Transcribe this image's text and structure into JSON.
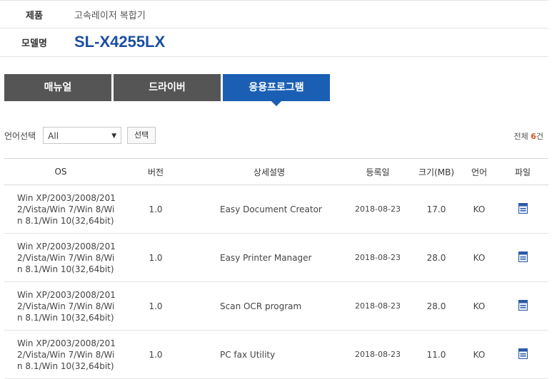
{
  "product": {
    "label": "제품",
    "value": "고속레이저 복합기",
    "model_label": "모델명",
    "model_value": "SL-X4255LX"
  },
  "tabs": [
    {
      "label": "매뉴얼"
    },
    {
      "label": "드라이버"
    },
    {
      "label": "응용프로그램"
    }
  ],
  "active_tab": "응용프로그램",
  "filter": {
    "label": "언어선택",
    "selected": "All",
    "button": "선택",
    "total_prefix": "전체 ",
    "total_count": "6",
    "total_suffix": "건"
  },
  "table": {
    "headers": {
      "os": "OS",
      "version": "버전",
      "description": "상세설명",
      "date": "등록일",
      "size": "크기(MB)",
      "language": "언어",
      "file": "파일"
    },
    "rows": [
      {
        "os": "Win XP/2003/2008/2012/Vista/Win 7/Win 8/Win 8.1/Win 10(32,64bit)",
        "version": "1.0",
        "description": "Easy Document Creator",
        "date": "2018-08-23",
        "size": "17.0",
        "language": "KO"
      },
      {
        "os": "Win XP/2003/2008/2012/Vista/Win 7/Win 8/Win 8.1/Win 10(32,64bit)",
        "version": "1.0",
        "description": "Easy Printer Manager",
        "date": "2018-08-23",
        "size": "28.0",
        "language": "KO"
      },
      {
        "os": "Win XP/2003/2008/2012/Vista/Win 7/Win 8/Win 8.1/Win 10(32,64bit)",
        "version": "1.0",
        "description": "Scan OCR program",
        "date": "2018-08-23",
        "size": "28.0",
        "language": "KO"
      },
      {
        "os": "Win XP/2003/2008/2012/Vista/Win 7/Win 8/Win 8.1/Win 10(32,64bit)",
        "version": "1.0",
        "description": "PC fax Utility",
        "date": "2018-08-23",
        "size": "11.0",
        "language": "KO"
      }
    ]
  },
  "colors": {
    "accent": "#1a5fb4",
    "tab_inactive": "#555555",
    "model": "#1a4fa3",
    "count": "#d9531e"
  },
  "icons": {
    "file": "download-file-icon",
    "select": "chevron-down-icon"
  }
}
